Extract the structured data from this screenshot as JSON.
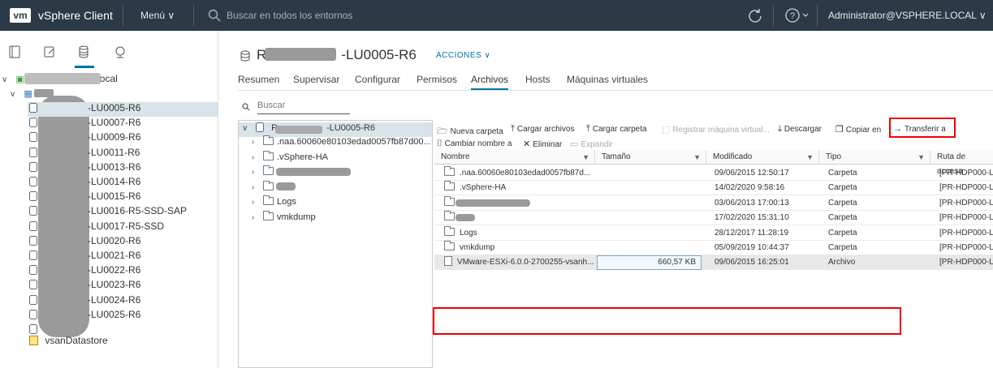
{
  "topbar": {
    "logo": "vm",
    "app_title": "vSphere Client",
    "menu_label": "Menú",
    "search_placeholder": "Buscar en todos los entornos",
    "user_label": "Administrator@VSPHERE.LOCAL"
  },
  "nav": {
    "root_suffix": "ocal",
    "datastores": [
      "-LU0005-R6",
      "-LU0007-R6",
      "-LU0009-R6",
      "-LU0011-R6",
      "-LU0013-R6",
      "-LU0014-R6",
      "-LU0015-R6",
      "-LU0016-R5-SSD-SAP",
      "-LU0017-R5-SSD",
      "-LU0020-R6",
      "-LU0021-R6",
      "-LU0022-R6",
      "-LU0023-R6",
      "-LU0024-R6",
      "-LU0025-R6",
      ""
    ],
    "vsan": "vsanDatastore"
  },
  "main": {
    "title_suffix": "-LU0005-R6",
    "actions_label": "ACCIONES",
    "tabs": [
      "Resumen",
      "Supervisar",
      "Configurar",
      "Permisos",
      "Archivos",
      "Hosts",
      "Máquinas virtuales"
    ]
  },
  "filetree": {
    "search_label": "Buscar",
    "root_label": "-LU0005-R6",
    "folders": [
      ".naa.60060e80103edad0057fb87d00...",
      ".vSphere-HA",
      "",
      "",
      "Logs",
      "vmkdump"
    ]
  },
  "toolbar": {
    "new_folder": "Nueva carpeta",
    "upload_files": "Cargar archivos",
    "upload_folder": "Cargar carpeta",
    "register_vm": "Registrar máquina virtual...",
    "download": "Descargar",
    "copy_to": "Copiar en",
    "move_to": "Transferir a",
    "rename": "Cambiar nombre a",
    "delete": "Eliminar",
    "expand": "Expandir"
  },
  "grid": {
    "columns": [
      "Nombre",
      "Tamaño",
      "Modificado",
      "Tipo",
      "Ruta de acceso"
    ],
    "rows": [
      {
        "name": ".naa.60060e80103edad0057fb87d...",
        "size": "",
        "modified": "09/06/2015 12:50:17",
        "type": "Carpeta",
        "path": "[PR-HDP000-L"
      },
      {
        "name": ".vSphere-HA",
        "size": "",
        "modified": "14/02/2020 9:58:16",
        "type": "Carpeta",
        "path": "[PR-HDP000-L"
      },
      {
        "name": "",
        "size": "",
        "modified": "03/06/2013 17:00:13",
        "type": "Carpeta",
        "path": "[PR-HDP000-L"
      },
      {
        "name": "",
        "size": "",
        "modified": "17/02/2020 15:31:10",
        "type": "Carpeta",
        "path": "[PR-HDP000-L"
      },
      {
        "name": "Logs",
        "size": "",
        "modified": "28/12/2017 11:28:19",
        "type": "Carpeta",
        "path": "[PR-HDP000-L"
      },
      {
        "name": "vmkdump",
        "size": "",
        "modified": "05/09/2019 10:44:37",
        "type": "Carpeta",
        "path": "[PR-HDP000-L"
      },
      {
        "name": "VMware-ESXi-6.0.0-2700255-vsanh...",
        "size": "660,57 KB",
        "modified": "09/06/2015 16:25:01",
        "type": "Archivo",
        "path": "[PR-HDP000-L"
      }
    ]
  }
}
